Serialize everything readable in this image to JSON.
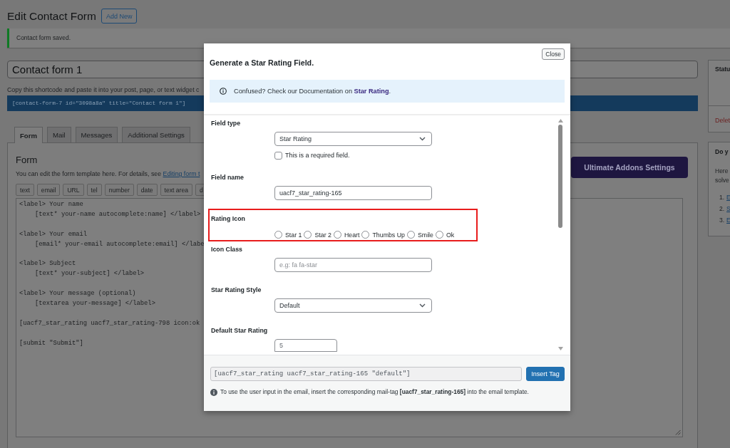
{
  "page": {
    "title": "Edit Contact Form",
    "add_new_button": "Add New"
  },
  "notice": {
    "text": "Contact form saved."
  },
  "form_title": {
    "value": "Contact form 1"
  },
  "shortcode": {
    "hint": "Copy this shortcode and paste it into your post, page, or text widget c",
    "code": "[contact-form-7 id=\"3098a8a\" title=\"Contact form 1\"]"
  },
  "tabs": [
    {
      "label": "Form",
      "selected": true
    },
    {
      "label": "Mail",
      "selected": false
    },
    {
      "label": "Messages",
      "selected": false
    },
    {
      "label": "Additional Settings",
      "selected": false
    }
  ],
  "form_panel": {
    "heading": "Form",
    "description": "You can edit the form template here. For details, see",
    "link": "Editing form t",
    "addons_button": "Ultimate Addons Settings",
    "tag_buttons": [
      "text",
      "email",
      "URL",
      "tel",
      "number",
      "date",
      "text area",
      "d"
    ],
    "template_blocks": [
      [
        "<label> Your name",
        "[text* your-name autocomplete:name] </label>"
      ],
      [
        "<label> Your email",
        "[email* your-email autocomplete:email] </labe"
      ],
      [
        "<label> Subject",
        "[text* your-subject] </label>"
      ],
      [
        "<label> Your message (optional)",
        "[textarea your-message] </label>"
      ],
      [
        "[uacf7_star_rating uacf7_star_rating-798 icon:ok"
      ],
      [
        "[submit \"Submit\"]"
      ]
    ]
  },
  "sidebar": {
    "status_box": {
      "title": "Statu",
      "delete_link": "Delet"
    },
    "help_box": {
      "title": "Do y",
      "lines": [
        "Here",
        "solve"
      ],
      "links": [
        {
          "number": "1.",
          "label": "E"
        },
        {
          "number": "2.",
          "label": "S"
        },
        {
          "number": "3.",
          "label": "E"
        }
      ]
    }
  },
  "modal": {
    "close_button": "Close",
    "title": "Generate a Star Rating Field.",
    "info": {
      "text": "Confused? Check our Documentation on",
      "link": "Star Rating",
      "after_link": "."
    },
    "fields": [
      {
        "kind": "select",
        "label": "Field type",
        "value": "Star Rating",
        "highlighted": false,
        "checkbox": {
          "label": "This is a required field.",
          "checked": false
        }
      },
      {
        "kind": "text",
        "label": "Field name",
        "value": "uacf7_star_rating-165",
        "highlighted": false
      },
      {
        "kind": "radio",
        "label": "Rating Icon",
        "highlighted": true,
        "options": [
          {
            "label": "Star 1",
            "selected": false
          },
          {
            "label": "Star 2",
            "selected": false
          },
          {
            "label": "Heart",
            "selected": false
          },
          {
            "label": "Thumbs Up",
            "selected": false
          },
          {
            "label": "Smile",
            "selected": false
          },
          {
            "label": "Ok",
            "selected": false
          }
        ]
      },
      {
        "kind": "text",
        "label": "Icon Class",
        "placeholder": "e.g: fa fa-star",
        "highlighted": false
      },
      {
        "kind": "select",
        "label": "Star Rating Style",
        "value": "Default",
        "highlighted": false
      },
      {
        "kind": "number",
        "label": "Default Star Rating",
        "value": "5",
        "highlighted": false
      }
    ],
    "tag_code": "[uacf7_star_rating uacf7_star_rating-165 \"default\"]",
    "insert_button": "Insert Tag",
    "note": "To use the user input in the email, insert the corresponding mail-tag **[uacf7_star_rating-165]** into the email template."
  }
}
